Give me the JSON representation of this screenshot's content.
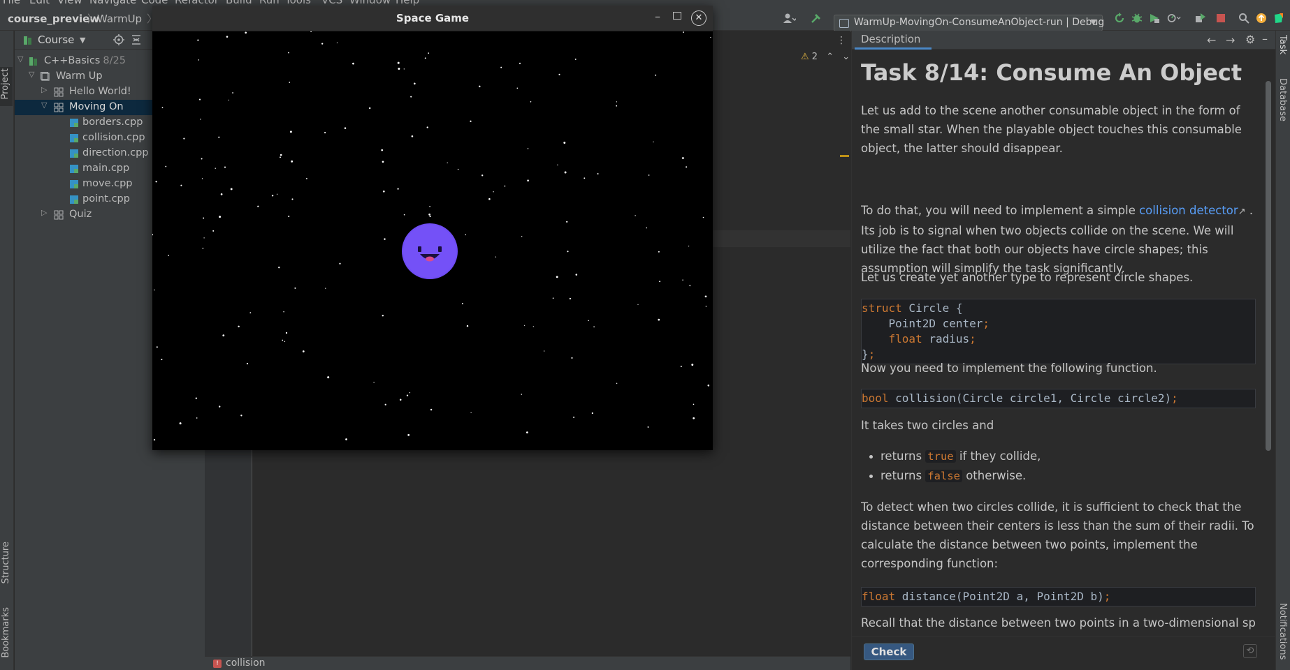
{
  "menu": [
    "File",
    "Edit",
    "View",
    "Navigate",
    "Code",
    "Refactor",
    "Build",
    "Run",
    "Tools",
    "VCS",
    "Window",
    "Help"
  ],
  "breadcrumb": {
    "root": "course_preview",
    "child": "WarmUp",
    "sep": "〉"
  },
  "run_config": {
    "label": "WarmUp-MovingOn-ConsumeAnObject-run | Debug"
  },
  "left_stripe": {
    "project": "Project",
    "structure": "Structure",
    "bookmarks": "Bookmarks"
  },
  "project_panel": {
    "title": "Course",
    "tree": [
      {
        "label": "C++Basics",
        "count": "8/25",
        "depth": 0,
        "expanded": true,
        "type": "course"
      },
      {
        "label": "Warm Up",
        "count": "",
        "depth": 1,
        "expanded": true,
        "type": "section"
      },
      {
        "label": "Hello World!",
        "count": "",
        "depth": 2,
        "expanded": false,
        "type": "lesson"
      },
      {
        "label": "Moving On",
        "count": "",
        "depth": 2,
        "expanded": true,
        "type": "lesson",
        "selected": true
      },
      {
        "label": "borders.cpp",
        "count": "",
        "depth": 3,
        "type": "file"
      },
      {
        "label": "collision.cpp",
        "count": "",
        "depth": 3,
        "type": "file"
      },
      {
        "label": "direction.cpp",
        "count": "",
        "depth": 3,
        "type": "file"
      },
      {
        "label": "main.cpp",
        "count": "",
        "depth": 3,
        "type": "file"
      },
      {
        "label": "move.cpp",
        "count": "",
        "depth": 3,
        "type": "file"
      },
      {
        "label": "point.cpp",
        "count": "",
        "depth": 3,
        "type": "file"
      },
      {
        "label": "Quiz",
        "count": "",
        "depth": 2,
        "expanded": false,
        "type": "lesson"
      }
    ]
  },
  "editor": {
    "warnings": "2",
    "bottom_tab": "collision"
  },
  "game_window": {
    "title": "Space Game",
    "close": "✕",
    "minimize": "–",
    "player_color": "#6f4cf5"
  },
  "task_panel": {
    "tab": "Description",
    "title": "Task 8/14: Consume An Object",
    "p1": "Let us add to the scene another consumable object in the form of the small star. When the playable object touches this consumable object, the latter should disappear.",
    "p2_pre": "To do that, you will need to implement a simple ",
    "p2_link": "collision detector",
    "p2_post": " . Its job is to signal when two objects collide on the scene. We will utilize the fact that both our objects have circle shapes; this assumption will simplify the task significantly.",
    "p3": "Let us create yet another type to represent circle shapes.",
    "code1": {
      "l1_kw": "struct",
      "l1_rest": " Circle {",
      "l2": "    Point2D center",
      "l3_kw": "float",
      "l3_rest": " radius",
      "l4": "}",
      "semi": ";"
    },
    "p4": "Now you need to implement the following function.",
    "code2": {
      "kw": "bool",
      "rest": " collision(Circle circle1, Circle circle2)",
      "semi": ";"
    },
    "p5": "It takes two circles and",
    "bullet1": {
      "pre": "returns ",
      "code": "true",
      "post": " if they collide,"
    },
    "bullet2": {
      "pre": "returns ",
      "code": "false",
      "post": " otherwise."
    },
    "p6": "To detect when two circles collide, it is sufficient to check that the distance between their centers is less than the sum of their radii. To calculate the distance between two points, implement the corresponding function:",
    "code3": {
      "kw": "float",
      "rest": " distance(Point2D a, Point2D b)",
      "semi": ";"
    },
    "p7": "Recall that the distance between two points in a two-dimensional space",
    "check": "Check",
    "reset": "⟲"
  },
  "right_stripe": {
    "task": "Task",
    "database": "Database",
    "notifications": "Notifications"
  },
  "colors": {
    "accent": "#4a88c7",
    "selection": "#0d293e",
    "keyword": "#cc7832",
    "link": "#589df6"
  }
}
